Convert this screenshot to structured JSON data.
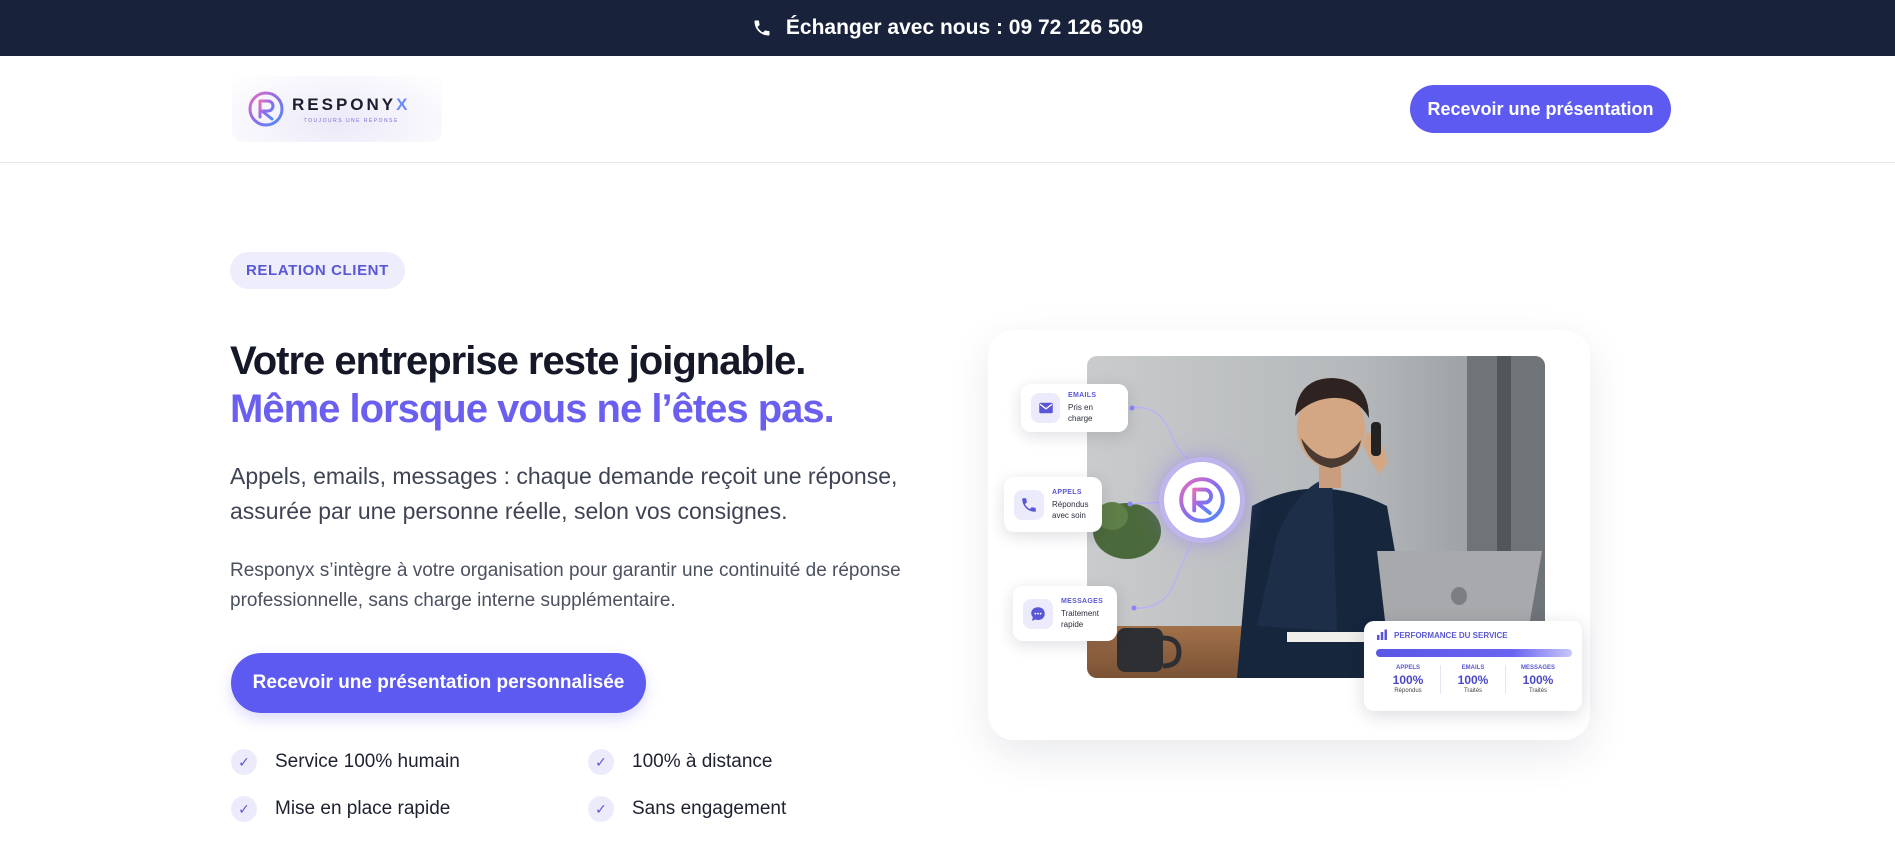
{
  "topbar": {
    "phone_icon": "phone-icon",
    "text": "Échanger avec nous : 09 72 126 509"
  },
  "header": {
    "logo": {
      "word_main": "RESPONY",
      "word_end": "X",
      "tagline": "TOUJOURS UNE RÉPONSE"
    },
    "cta_label": "Recevoir une présentation"
  },
  "hero": {
    "eyebrow": "RELATION CLIENT",
    "title_line1": "Votre entreprise reste joignable.",
    "title_line2": "Même lorsque vous ne l’êtes pas.",
    "lead": "Appels, emails, messages : chaque demande reçoit une réponse, assurée par une personne réelle, selon vos consignes.",
    "body": "Responyx s’intègre à votre organisation pour garantir une continuité de réponse professionnelle, sans charge interne supplémentaire.",
    "cta_label": "Recevoir une présentation personnalisée",
    "features": [
      {
        "check": "✓",
        "label": "Service 100% humain"
      },
      {
        "check": "✓",
        "label": "100% à distance"
      },
      {
        "check": "✓",
        "label": "Mise en place rapide"
      },
      {
        "check": "✓",
        "label": "Sans engagement"
      }
    ]
  },
  "visual": {
    "emails": {
      "title": "EMAILS",
      "line": "Pris en charge",
      "icon": "mail-icon"
    },
    "appels": {
      "title": "APPELS",
      "line1": "Répondus",
      "line2": "avec soin",
      "icon": "phone-icon"
    },
    "messages": {
      "title": "MESSAGES",
      "line1": "Traitement",
      "line2": "rapide",
      "icon": "chat-icon"
    },
    "performance": {
      "title": "PERFORMANCE DU SERVICE",
      "icon": "bar-chart-icon",
      "progress": 1.0,
      "columns": [
        {
          "label": "APPELS",
          "value": "100%",
          "sub": "Répondus"
        },
        {
          "label": "EMAILS",
          "value": "100%",
          "sub": "Traités"
        },
        {
          "label": "MESSAGES",
          "value": "100%",
          "sub": "Traités"
        }
      ]
    }
  },
  "colors": {
    "accent": "#5d5af2",
    "accent_text": "#6b5ff0",
    "topbar": "#18233b"
  }
}
